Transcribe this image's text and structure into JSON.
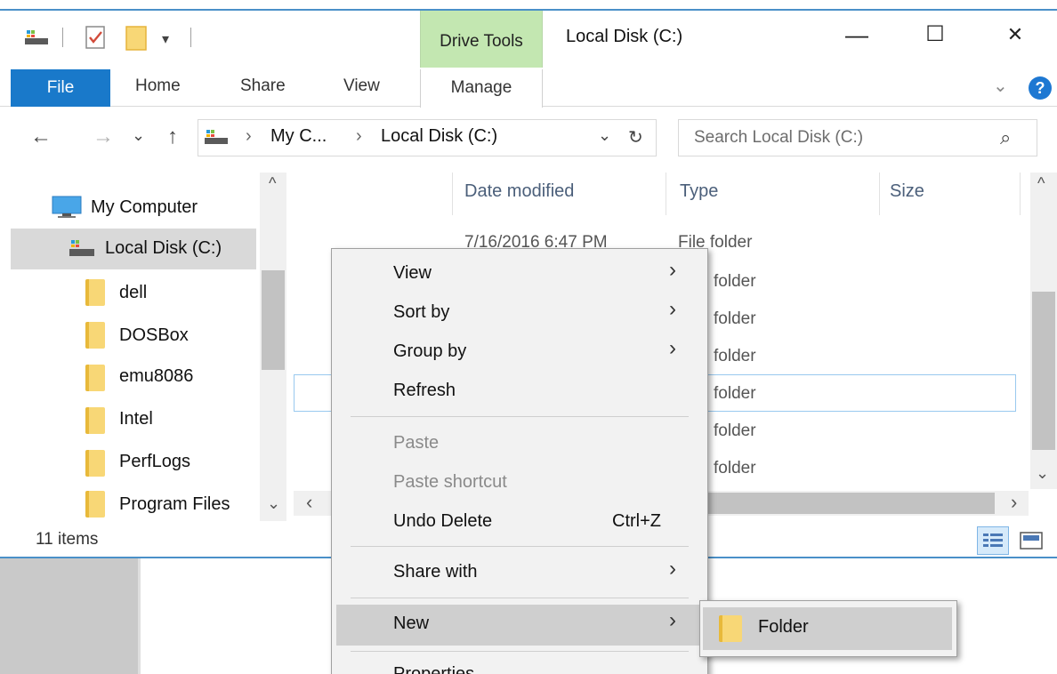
{
  "titlebar": {
    "context_tab": "Drive Tools",
    "window_title": "Local Disk (C:)",
    "minimize": "—",
    "maximize": "☐",
    "close": "✕"
  },
  "ribbon": {
    "tabs": [
      "File",
      "Home",
      "Share",
      "View",
      "Manage"
    ],
    "help": "?",
    "expand": "⌄"
  },
  "address": {
    "back": "←",
    "forward": "→",
    "recent": "⌄",
    "up": "↑",
    "crumb_sep": "›",
    "crumbs": [
      "My C...",
      "Local Disk (C:)"
    ],
    "dropdown": "⌄",
    "refresh": "↻",
    "search_placeholder": "Search Local Disk (C:)",
    "search_icon": "⌕"
  },
  "nav": {
    "my_computer": "My Computer",
    "local_disk": "Local Disk (C:)",
    "folders": [
      "dell",
      "DOSBox",
      "emu8086",
      "Intel",
      "PerfLogs",
      "Program Files"
    ],
    "scroll_up": "^",
    "scroll_down": "⌄",
    "scroll_left": "‹"
  },
  "content": {
    "columns": [
      "Date modified",
      "Type",
      "Size"
    ],
    "first_row_date": "7/16/2016 6:47 PM",
    "first_row_type": "File folder",
    "visible_type_fragments": [
      "folder",
      "folder",
      "folder",
      "folder",
      "folder",
      "folder"
    ],
    "scroll_up": "^",
    "scroll_down": "⌄",
    "scroll_right": "›"
  },
  "status": {
    "item_count": "11 items"
  },
  "context_menu": {
    "items": [
      {
        "label": "View",
        "submenu": true
      },
      {
        "label": "Sort by",
        "submenu": true
      },
      {
        "label": "Group by",
        "submenu": true
      },
      {
        "label": "Refresh"
      },
      {
        "label": "Paste",
        "disabled": true
      },
      {
        "label": "Paste shortcut",
        "disabled": true
      },
      {
        "label": "Undo Delete",
        "shortcut": "Ctrl+Z"
      },
      {
        "label": "Share with",
        "submenu": true
      },
      {
        "label": "New",
        "submenu": true,
        "highlighted": true
      },
      {
        "label": "Properties"
      }
    ],
    "arrow": "›"
  },
  "new_submenu": {
    "items": [
      {
        "label": "Folder",
        "highlighted": true
      }
    ]
  },
  "colors": {
    "file_tab": "#1979ca",
    "drive_tools": "#c3e7b1",
    "window_border": "#4a90c8",
    "menu_highlight": "#cfcfcf"
  }
}
